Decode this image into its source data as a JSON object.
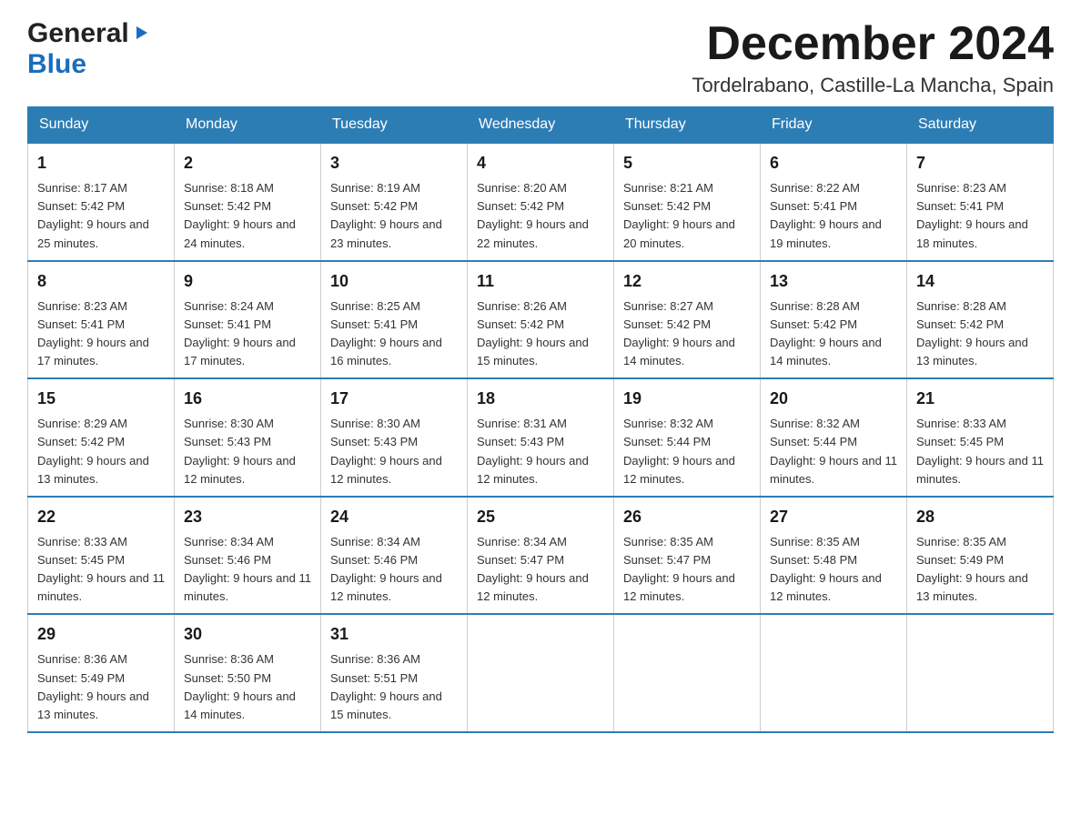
{
  "header": {
    "logo_general": "General",
    "logo_blue": "Blue",
    "month_title": "December 2024",
    "location": "Tordelrabano, Castille-La Mancha, Spain"
  },
  "days_of_week": [
    "Sunday",
    "Monday",
    "Tuesday",
    "Wednesday",
    "Thursday",
    "Friday",
    "Saturday"
  ],
  "weeks": [
    [
      {
        "day": "1",
        "sunrise": "8:17 AM",
        "sunset": "5:42 PM",
        "daylight": "9 hours and 25 minutes."
      },
      {
        "day": "2",
        "sunrise": "8:18 AM",
        "sunset": "5:42 PM",
        "daylight": "9 hours and 24 minutes."
      },
      {
        "day": "3",
        "sunrise": "8:19 AM",
        "sunset": "5:42 PM",
        "daylight": "9 hours and 23 minutes."
      },
      {
        "day": "4",
        "sunrise": "8:20 AM",
        "sunset": "5:42 PM",
        "daylight": "9 hours and 22 minutes."
      },
      {
        "day": "5",
        "sunrise": "8:21 AM",
        "sunset": "5:42 PM",
        "daylight": "9 hours and 20 minutes."
      },
      {
        "day": "6",
        "sunrise": "8:22 AM",
        "sunset": "5:41 PM",
        "daylight": "9 hours and 19 minutes."
      },
      {
        "day": "7",
        "sunrise": "8:23 AM",
        "sunset": "5:41 PM",
        "daylight": "9 hours and 18 minutes."
      }
    ],
    [
      {
        "day": "8",
        "sunrise": "8:23 AM",
        "sunset": "5:41 PM",
        "daylight": "9 hours and 17 minutes."
      },
      {
        "day": "9",
        "sunrise": "8:24 AM",
        "sunset": "5:41 PM",
        "daylight": "9 hours and 17 minutes."
      },
      {
        "day": "10",
        "sunrise": "8:25 AM",
        "sunset": "5:41 PM",
        "daylight": "9 hours and 16 minutes."
      },
      {
        "day": "11",
        "sunrise": "8:26 AM",
        "sunset": "5:42 PM",
        "daylight": "9 hours and 15 minutes."
      },
      {
        "day": "12",
        "sunrise": "8:27 AM",
        "sunset": "5:42 PM",
        "daylight": "9 hours and 14 minutes."
      },
      {
        "day": "13",
        "sunrise": "8:28 AM",
        "sunset": "5:42 PM",
        "daylight": "9 hours and 14 minutes."
      },
      {
        "day": "14",
        "sunrise": "8:28 AM",
        "sunset": "5:42 PM",
        "daylight": "9 hours and 13 minutes."
      }
    ],
    [
      {
        "day": "15",
        "sunrise": "8:29 AM",
        "sunset": "5:42 PM",
        "daylight": "9 hours and 13 minutes."
      },
      {
        "day": "16",
        "sunrise": "8:30 AM",
        "sunset": "5:43 PM",
        "daylight": "9 hours and 12 minutes."
      },
      {
        "day": "17",
        "sunrise": "8:30 AM",
        "sunset": "5:43 PM",
        "daylight": "9 hours and 12 minutes."
      },
      {
        "day": "18",
        "sunrise": "8:31 AM",
        "sunset": "5:43 PM",
        "daylight": "9 hours and 12 minutes."
      },
      {
        "day": "19",
        "sunrise": "8:32 AM",
        "sunset": "5:44 PM",
        "daylight": "9 hours and 12 minutes."
      },
      {
        "day": "20",
        "sunrise": "8:32 AM",
        "sunset": "5:44 PM",
        "daylight": "9 hours and 11 minutes."
      },
      {
        "day": "21",
        "sunrise": "8:33 AM",
        "sunset": "5:45 PM",
        "daylight": "9 hours and 11 minutes."
      }
    ],
    [
      {
        "day": "22",
        "sunrise": "8:33 AM",
        "sunset": "5:45 PM",
        "daylight": "9 hours and 11 minutes."
      },
      {
        "day": "23",
        "sunrise": "8:34 AM",
        "sunset": "5:46 PM",
        "daylight": "9 hours and 11 minutes."
      },
      {
        "day": "24",
        "sunrise": "8:34 AM",
        "sunset": "5:46 PM",
        "daylight": "9 hours and 12 minutes."
      },
      {
        "day": "25",
        "sunrise": "8:34 AM",
        "sunset": "5:47 PM",
        "daylight": "9 hours and 12 minutes."
      },
      {
        "day": "26",
        "sunrise": "8:35 AM",
        "sunset": "5:47 PM",
        "daylight": "9 hours and 12 minutes."
      },
      {
        "day": "27",
        "sunrise": "8:35 AM",
        "sunset": "5:48 PM",
        "daylight": "9 hours and 12 minutes."
      },
      {
        "day": "28",
        "sunrise": "8:35 AM",
        "sunset": "5:49 PM",
        "daylight": "9 hours and 13 minutes."
      }
    ],
    [
      {
        "day": "29",
        "sunrise": "8:36 AM",
        "sunset": "5:49 PM",
        "daylight": "9 hours and 13 minutes."
      },
      {
        "day": "30",
        "sunrise": "8:36 AM",
        "sunset": "5:50 PM",
        "daylight": "9 hours and 14 minutes."
      },
      {
        "day": "31",
        "sunrise": "8:36 AM",
        "sunset": "5:51 PM",
        "daylight": "9 hours and 15 minutes."
      },
      null,
      null,
      null,
      null
    ]
  ]
}
